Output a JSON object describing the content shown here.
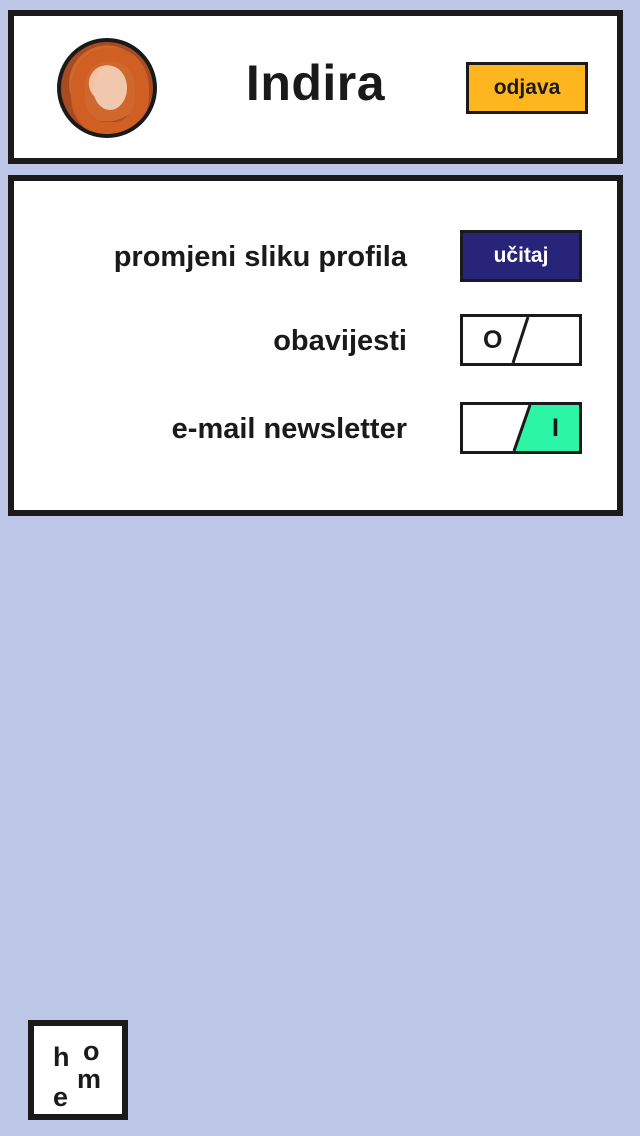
{
  "header": {
    "username": "Indira",
    "logout_label": "odjava",
    "avatar_icon": "profile-photo"
  },
  "settings": {
    "profile_picture": {
      "label": "promjeni sliku profila",
      "button_label": "učitaj"
    },
    "notifications": {
      "label": "obavijesti",
      "toggle_text": "O",
      "state": "off"
    },
    "newsletter": {
      "label": "e-mail newsletter",
      "toggle_text": "I",
      "state": "on"
    }
  },
  "home": {
    "letters": [
      "h",
      "o",
      "e",
      "m"
    ],
    "icon": "home-icon"
  },
  "colors": {
    "background": "#bdc6e6",
    "logout": "#ffb51e",
    "upload": "#27247a",
    "toggle_on": "#2cf5a5",
    "border": "#1a1a1a"
  }
}
